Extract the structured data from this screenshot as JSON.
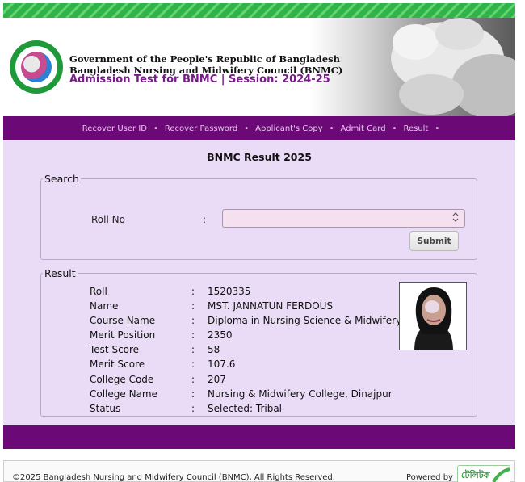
{
  "header": {
    "org_line1": "Government of the People's Republic of Bangladesh",
    "org_line2": "Bangladesh Nursing and Midwifery Council (BNMC)",
    "session_title": "Admission Test for BNMC | Session: 2024-25"
  },
  "nav": {
    "items": [
      {
        "label": "Recover User ID"
      },
      {
        "label": "Recover Password"
      },
      {
        "label": "Applicant's Copy"
      },
      {
        "label": "Admit Card"
      },
      {
        "label": "Result"
      }
    ],
    "separator": "•"
  },
  "page_title": "BNMC Result 2025",
  "search": {
    "legend": "Search",
    "roll_label": "Roll No",
    "colon": ":",
    "roll_value": "",
    "submit_label": "Submit"
  },
  "result": {
    "legend": "Result",
    "fields": [
      {
        "label": "Roll",
        "value": "1520335"
      },
      {
        "label": "Name",
        "value": "MST. JANNATUN FERDOUS"
      },
      {
        "label": "Course Name",
        "value": "Diploma in Nursing Science & Midwifery"
      },
      {
        "label": "Merit Position",
        "value": "2350"
      },
      {
        "label": "Test Score",
        "value": "58"
      },
      {
        "label": "Merit Score",
        "value": "107.6"
      },
      {
        "label": "College Code",
        "value": "207"
      },
      {
        "label": "College Name",
        "value": "Nursing & Midwifery College, Dinajpur"
      },
      {
        "label": "Status",
        "value": "Selected: Tribal"
      }
    ]
  },
  "footer": {
    "copyright": "©2025 Bangladesh Nursing and Midwifery Council (BNMC), All Rights Reserved.",
    "powered_by": "Powered by",
    "powered_logo_text": "টেলিটক"
  },
  "colors": {
    "purple": "#6b0a77",
    "content_bg": "#eadcf6",
    "stripe_green": "#2fb34a",
    "session_purple": "#7a1a8a"
  },
  "icons": {
    "logo": "bnmc-seal-icon",
    "spinner": "spin-arrows-icon",
    "teletalk": "teletalk-logo"
  }
}
